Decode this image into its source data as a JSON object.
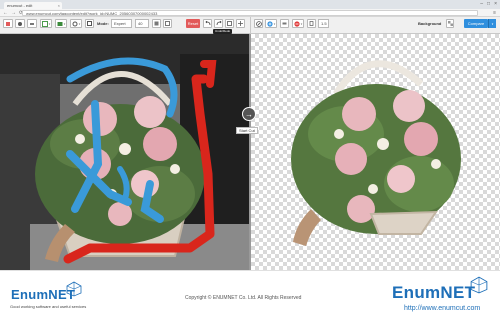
{
  "browser": {
    "tab_title": "enumcut - edit",
    "tab_close": "×",
    "url": "www.enumcut.com/tagcontent/edit?work_id=NUMC_20560307000002433",
    "nav": {
      "back": "←",
      "forward": "→",
      "reload": "⟳"
    },
    "window_controls": [
      "–",
      "□",
      "×"
    ],
    "menu_icon": "≡"
  },
  "toolbar": {
    "mode_label": "Mode:",
    "mode_value": "Expert",
    "size_value": "40",
    "reset_label": "Reset",
    "undo_tooltip": "Undo/Redo",
    "zoom_value": "1.5",
    "background_label": "Background",
    "compare_label": "Compare",
    "dropdown_caret": "▾"
  },
  "canvas": {
    "start_cut_label": "Start Cut",
    "start_cut_icon": "→"
  },
  "footer": {
    "brand_left": "EnumNET",
    "tagline": "Good working software and useful services",
    "copyright": "Copyright © ENUMNET Co. Ltd. All Rights Reserved",
    "brand_right": "EnumNET",
    "site_url": "http://www.enumcut.com"
  },
  "colors": {
    "brand_blue": "#1e6fb8",
    "foreground_stroke": "#3a9ad9",
    "background_stroke": "#d9261c",
    "reset_button": "#e25a5a",
    "compare_button": "#2f8fde"
  }
}
